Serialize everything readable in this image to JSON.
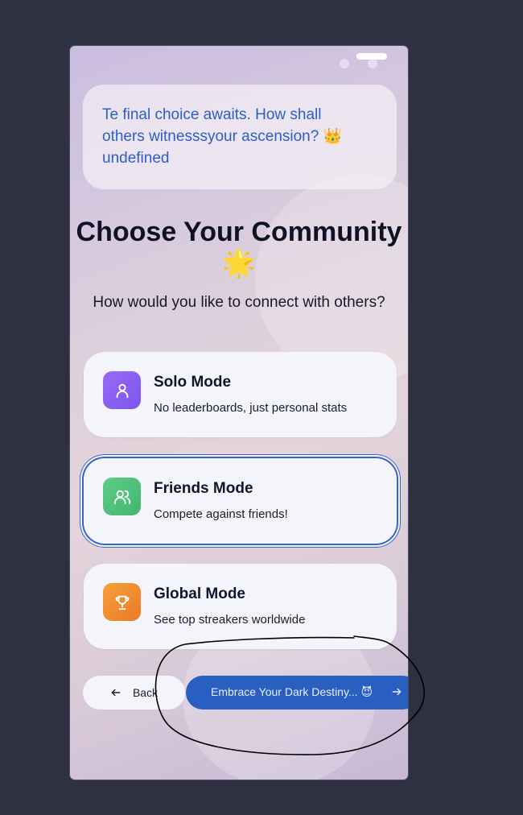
{
  "bubble": {
    "text": "Te final choice awaits. How shall others witnesssyour ascension? 👑 undefined"
  },
  "header": {
    "title": "Choose Your Community 🌟",
    "subtitle": "How would you like to connect with others?"
  },
  "options": [
    {
      "title": "Solo Mode",
      "description": "No leaderboards, just personal stats",
      "icon": "person-icon",
      "color": "#8b5cf6"
    },
    {
      "title": "Friends Mode",
      "description": "Compete against friends!",
      "icon": "users-icon",
      "color": "#4cc17a",
      "selected": true
    },
    {
      "title": "Global Mode",
      "description": "See top streakers worldwide",
      "icon": "trophy-icon",
      "color": "#f0892e"
    }
  ],
  "nav": {
    "back_label": "Back",
    "next_label": "Embrace Your Dark Destiny... 😈"
  },
  "colors": {
    "accent": "#2a5fc2",
    "background": "#2d3142",
    "annotation": "#000000"
  }
}
